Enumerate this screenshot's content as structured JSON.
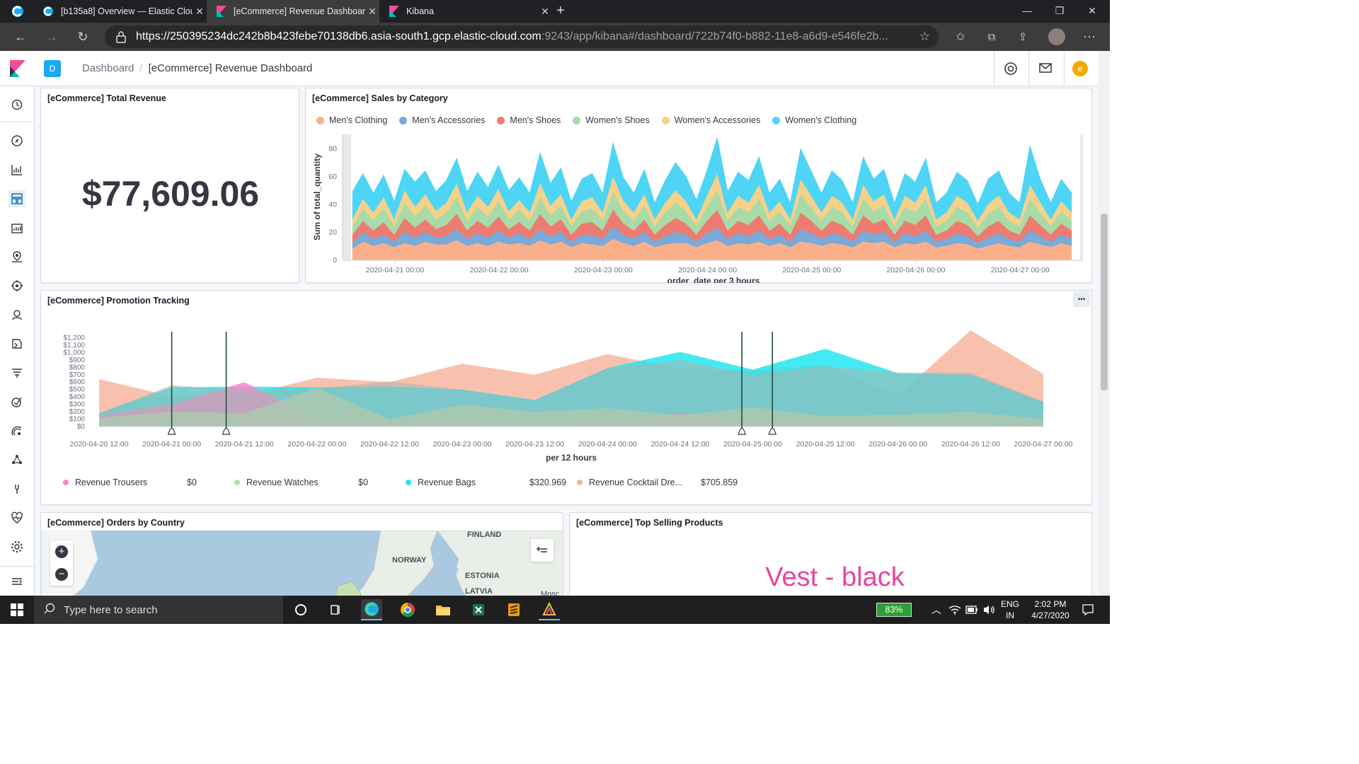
{
  "browser": {
    "tabs": [
      {
        "title": "[b135a8] Overview — Elastic Clou",
        "active": false
      },
      {
        "title": "[eCommerce] Revenue Dashboar",
        "active": true
      },
      {
        "title": "Kibana",
        "active": false
      }
    ],
    "new_tab": "+",
    "url_main": "https://250395234dc242b8b423febe70138db6.asia-south1.gcp.elastic-cloud.com",
    "url_rest": ":9243/app/kibana#/dashboard/722b74f0-b882-11e8-a6d9-e546fe2b..."
  },
  "kibana": {
    "space_badge": "D",
    "breadcrumb_root": "Dashboard",
    "breadcrumb_sep": "/",
    "breadcrumb_current": "[eCommerce] Revenue Dashboard",
    "user_initial": "e"
  },
  "panels": {
    "total_revenue": {
      "title": "[eCommerce] Total Revenue",
      "value": "$77,609.06"
    },
    "sales_by_category": {
      "title": "[eCommerce] Sales by Category"
    },
    "promotion_tracking": {
      "title": "[eCommerce] Promotion Tracking",
      "menu": "•••"
    },
    "orders_by_country": {
      "title": "[eCommerce] Orders by Country",
      "labels": [
        "FINLAND",
        "NORWAY",
        "ESTONIA",
        "LATVIA",
        "Mosc"
      ],
      "zoom_in": "+",
      "zoom_out": "−"
    },
    "top_selling": {
      "title": "[eCommerce] Top Selling Products",
      "word": "Vest - black"
    }
  },
  "chart_data": [
    {
      "type": "area",
      "stacked": true,
      "title": "",
      "xlabel": "order_date per 3 hours",
      "ylabel": "Sum of total_quantity",
      "ylim": [
        0,
        90
      ],
      "yticks": [
        0,
        20,
        40,
        60,
        80
      ],
      "xticks": [
        "2020-04-21 00:00",
        "2020-04-22 00:00",
        "2020-04-23 00:00",
        "2020-04-24 00:00",
        "2020-04-25 00:00",
        "2020-04-26 00:00",
        "2020-04-27 00:00"
      ],
      "legend_position": "top",
      "series": [
        {
          "name": "Men's Clothing",
          "color": "#f9b08a",
          "values": [
            8,
            13,
            10,
            12,
            9,
            12,
            10,
            13,
            11,
            11,
            14,
            10,
            12,
            10,
            13,
            11,
            12,
            10,
            14,
            11,
            13,
            9,
            12,
            11,
            10,
            15,
            12,
            10,
            13,
            9,
            11,
            12,
            12,
            9,
            12,
            14,
            10,
            12,
            11,
            13,
            10,
            12,
            9,
            13,
            12,
            10,
            12,
            11,
            9,
            13,
            12,
            13,
            9,
            12,
            11,
            13,
            9,
            10,
            12,
            11,
            8,
            10,
            12,
            10,
            9,
            13,
            11,
            9,
            12,
            10
          ]
        },
        {
          "name": "Men's Accessories",
          "color": "#79aad9",
          "values": [
            4,
            7,
            5,
            6,
            4,
            8,
            6,
            7,
            5,
            6,
            8,
            5,
            7,
            6,
            8,
            5,
            7,
            5,
            8,
            6,
            7,
            4,
            6,
            7,
            5,
            9,
            6,
            5,
            7,
            4,
            6,
            8,
            6,
            4,
            7,
            9,
            5,
            7,
            6,
            8,
            5,
            6,
            4,
            9,
            7,
            5,
            7,
            6,
            4,
            8,
            6,
            7,
            4,
            7,
            6,
            8,
            4,
            5,
            7,
            6,
            4,
            6,
            7,
            5,
            4,
            8,
            6,
            4,
            6,
            5
          ]
        },
        {
          "name": "Men's Shoes",
          "color": "#ee7b6f",
          "values": [
            6,
            8,
            6,
            9,
            5,
            10,
            7,
            9,
            6,
            8,
            11,
            6,
            9,
            7,
            10,
            6,
            8,
            6,
            11,
            7,
            9,
            5,
            8,
            9,
            6,
            12,
            8,
            6,
            9,
            5,
            8,
            10,
            8,
            5,
            9,
            13,
            6,
            9,
            8,
            11,
            6,
            8,
            5,
            12,
            9,
            6,
            9,
            8,
            5,
            11,
            8,
            9,
            5,
            9,
            8,
            11,
            5,
            6,
            9,
            8,
            5,
            8,
            9,
            6,
            5,
            11,
            8,
            5,
            8,
            6
          ]
        },
        {
          "name": "Women's Shoes",
          "color": "#a8dba8",
          "values": [
            6,
            9,
            7,
            10,
            6,
            11,
            8,
            10,
            7,
            9,
            12,
            7,
            10,
            8,
            11,
            7,
            9,
            7,
            12,
            8,
            10,
            6,
            9,
            10,
            7,
            13,
            9,
            7,
            10,
            6,
            9,
            11,
            9,
            6,
            10,
            14,
            7,
            10,
            9,
            12,
            7,
            9,
            6,
            13,
            10,
            7,
            10,
            9,
            6,
            12,
            9,
            10,
            6,
            10,
            9,
            12,
            6,
            7,
            10,
            9,
            6,
            9,
            10,
            7,
            6,
            12,
            9,
            6,
            9,
            7
          ]
        },
        {
          "name": "Women's Accessories",
          "color": "#f6d189",
          "values": [
            5,
            7,
            6,
            8,
            5,
            9,
            7,
            8,
            6,
            7,
            10,
            6,
            8,
            7,
            9,
            6,
            7,
            6,
            10,
            7,
            8,
            5,
            7,
            8,
            6,
            11,
            7,
            6,
            8,
            5,
            7,
            9,
            7,
            5,
            8,
            12,
            6,
            8,
            7,
            10,
            6,
            7,
            5,
            11,
            8,
            6,
            8,
            7,
            5,
            10,
            7,
            8,
            5,
            8,
            7,
            10,
            5,
            6,
            8,
            7,
            5,
            7,
            8,
            6,
            5,
            10,
            7,
            5,
            7,
            6
          ]
        },
        {
          "name": "Women's Clothing",
          "color": "#4ed5f5",
          "values": [
            20,
            18,
            14,
            16,
            13,
            15,
            18,
            17,
            14,
            16,
            18,
            15,
            17,
            14,
            17,
            15,
            16,
            14,
            22,
            16,
            19,
            13,
            16,
            17,
            14,
            24,
            17,
            14,
            18,
            12,
            16,
            20,
            18,
            14,
            18,
            26,
            15,
            17,
            16,
            20,
            14,
            16,
            12,
            22,
            18,
            14,
            18,
            16,
            12,
            20,
            16,
            18,
            12,
            16,
            15,
            19,
            12,
            14,
            17,
            16,
            12,
            18,
            18,
            14,
            12,
            28,
            17,
            12,
            16,
            14
          ]
        }
      ]
    },
    {
      "type": "area",
      "stacked": false,
      "title": "",
      "xlabel": "per 12 hours",
      "ylabel": "",
      "ylim": [
        0,
        1300
      ],
      "yticks": [
        "$0",
        "$100",
        "$200",
        "$300",
        "$400",
        "$500",
        "$600",
        "$700",
        "$800",
        "$900",
        "$1,000",
        "$1,100",
        "$1,200"
      ],
      "x": [
        "2020-04-20 12:00",
        "2020-04-21 00:00",
        "2020-04-21 12:00",
        "2020-04-22 00:00",
        "2020-04-22 12:00",
        "2020-04-23 00:00",
        "2020-04-23 12:00",
        "2020-04-24 00:00",
        "2020-04-24 12:00",
        "2020-04-25 00:00",
        "2020-04-25 12:00",
        "2020-04-26 00:00",
        "2020-04-26 12:00",
        "2020-04-27 00:00"
      ],
      "legend_position": "bottom",
      "annotations_x": [
        "2020-04-21 00:00",
        "2020-04-21 12:00",
        "2020-04-25 00:00",
        "2020-04-25 02:00"
      ],
      "series": [
        {
          "name": "Revenue Trousers",
          "color": "#f588c8",
          "legend_value": "$0",
          "values": [
            150,
            300,
            600,
            100,
            80,
            60,
            40,
            70,
            180,
            100,
            120,
            50,
            40,
            20
          ]
        },
        {
          "name": "Revenue Watches",
          "color": "#aee0ae",
          "legend_value": "$0",
          "values": [
            120,
            200,
            180,
            520,
            100,
            300,
            200,
            250,
            150,
            260,
            140,
            160,
            200,
            100
          ]
        },
        {
          "name": "Revenue Bags",
          "color": "#22e6f0",
          "legend_value": "$320.969",
          "values": [
            180,
            530,
            540,
            530,
            540,
            500,
            360,
            790,
            1010,
            770,
            1050,
            720,
            700,
            330
          ]
        },
        {
          "name": "Revenue Cocktail Dre...",
          "color": "#f7b6a0",
          "legend_value": "$705.859",
          "values": [
            640,
            410,
            420,
            660,
            600,
            850,
            700,
            980,
            780,
            760,
            830,
            420,
            1300,
            710
          ]
        }
      ],
      "grey_overlay": [
        180,
        560,
        480,
        510,
        610,
        500,
        360,
        790,
        900,
        700,
        820,
        730,
        730,
        340
      ]
    }
  ],
  "taskbar": {
    "search_placeholder": "Type here to search",
    "battery": "83%",
    "lang_top": "ENG",
    "lang_bottom": "IN",
    "time": "2:02 PM",
    "date": "4/27/2020"
  }
}
